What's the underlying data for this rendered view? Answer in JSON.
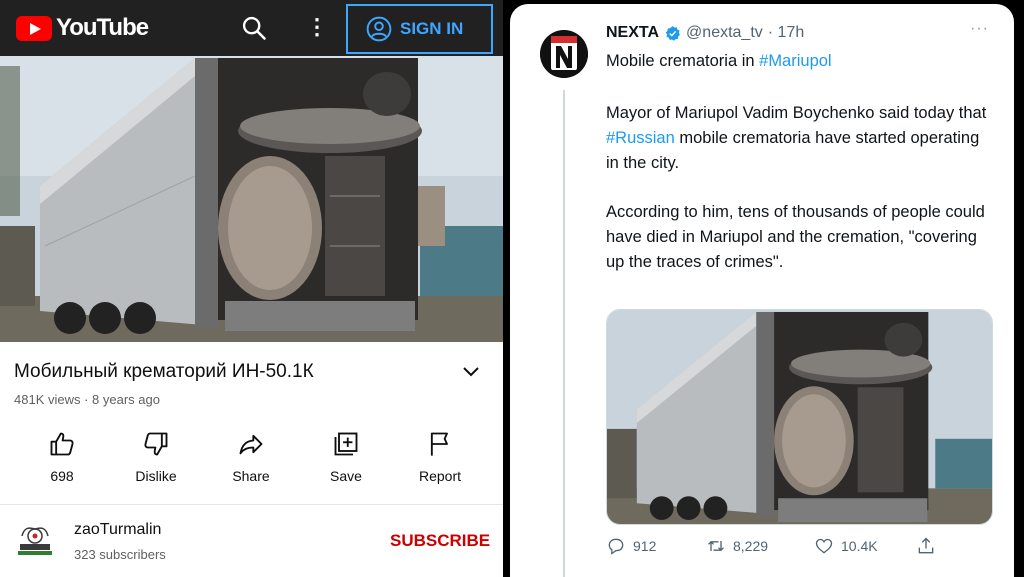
{
  "youtube": {
    "logo_text": "YouTube",
    "search_icon": "search-icon",
    "more_icon": "more-vert-icon",
    "more_glyph": "⋮",
    "sign_in_label": "SIGN IN",
    "video_title": "Мобильный крематорий ИН-50.1К",
    "meta": "481K views · 8 years ago",
    "actions": [
      {
        "label": "698",
        "icon": "thumbs-up-icon"
      },
      {
        "label": "Dislike",
        "icon": "thumbs-down-icon"
      },
      {
        "label": "Share",
        "icon": "share-icon"
      },
      {
        "label": "Save",
        "icon": "add-to-playlist-icon"
      },
      {
        "label": "Report",
        "icon": "flag-icon"
      }
    ],
    "channel": {
      "name": "zaoTurmalin",
      "subscribers": "323 subscribers"
    },
    "subscribe_label": "SUBSCRIBE",
    "colors": {
      "header": "#212121",
      "brand_red": "#ff0000",
      "signin_blue": "#3ea6ff",
      "subscribe_red": "#cc0000"
    }
  },
  "tweet": {
    "name": "NEXTA",
    "handle": "@nexta_tv",
    "time": "· 17h",
    "more_glyph": "···",
    "line1_text": "Mobile crematoria in ",
    "line1_tag": "#Mariupol",
    "p2_a": "Mayor of Mariupol Vadim Boychenko said today that ",
    "p2_tag": "#Russian",
    "p2_b": " mobile crematoria have started operating in the city.",
    "p3": "According to him, tens of thousands of people could have died in Mariupol and the cremation, \"covering up the traces of crimes\".",
    "stats": {
      "replies": "912",
      "retweets": "8,229",
      "likes": "10.4K"
    },
    "colors": {
      "link": "#1d9bf0",
      "text": "#0f1419",
      "muted": "#536471"
    }
  }
}
